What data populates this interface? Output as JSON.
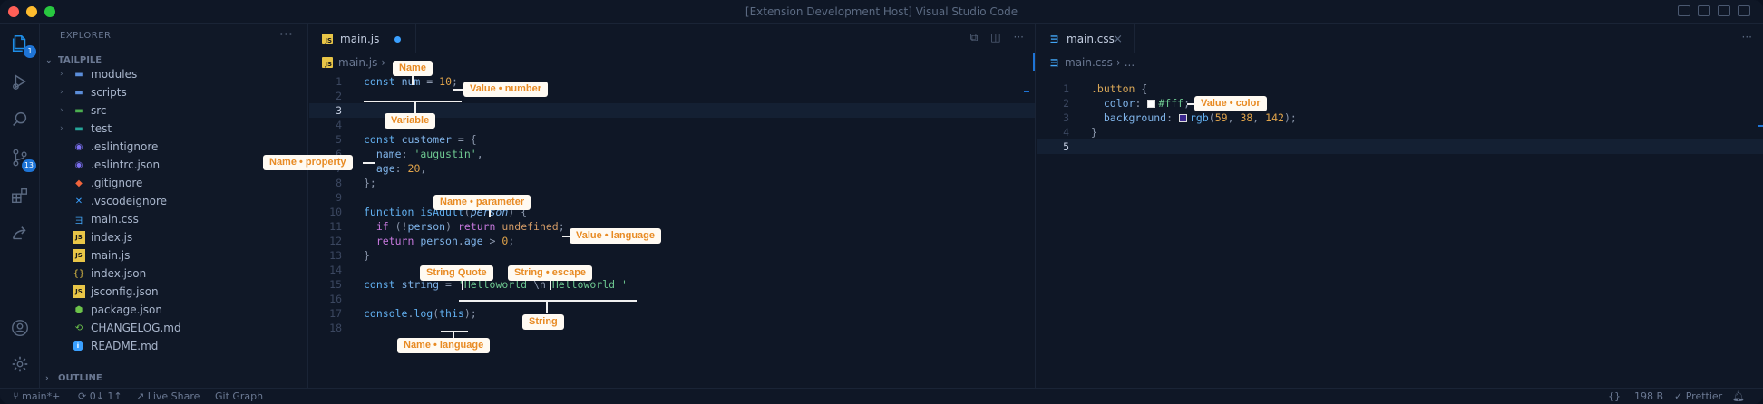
{
  "window": {
    "title": "[Extension Development Host] Visual Studio Code"
  },
  "activity": {
    "explorer_badge": "1",
    "source_control_badge": "13"
  },
  "sidebar": {
    "header": "EXPLORER",
    "root": "TAILPILE",
    "outline": "OUTLINE",
    "items": [
      {
        "label": "modules",
        "icon": "folder-icon",
        "kind": "folder"
      },
      {
        "label": "scripts",
        "icon": "folder-icon",
        "kind": "folder"
      },
      {
        "label": "src",
        "icon": "folder-icon",
        "kind": "folder"
      },
      {
        "label": "test",
        "icon": "folder-icon",
        "kind": "folder"
      },
      {
        "label": ".eslintignore",
        "icon": "eslint-icon",
        "kind": "file"
      },
      {
        "label": ".eslintrc.json",
        "icon": "eslint-icon",
        "kind": "file"
      },
      {
        "label": ".gitignore",
        "icon": "git-icon",
        "kind": "file"
      },
      {
        "label": ".vscodeignore",
        "icon": "vscode-icon",
        "kind": "file"
      },
      {
        "label": "main.css",
        "icon": "css-icon",
        "kind": "file"
      },
      {
        "label": "index.js",
        "icon": "js-icon",
        "kind": "file"
      },
      {
        "label": "main.js",
        "icon": "js-icon",
        "kind": "file"
      },
      {
        "label": "index.json",
        "icon": "json-icon",
        "kind": "file"
      },
      {
        "label": "jsconfig.json",
        "icon": "jsconfig-icon",
        "kind": "file"
      },
      {
        "label": "package.json",
        "icon": "nodejs-icon",
        "kind": "file"
      },
      {
        "label": "CHANGELOG.md",
        "icon": "changelog-icon",
        "kind": "file"
      },
      {
        "label": "README.md",
        "icon": "info-icon",
        "kind": "file"
      }
    ]
  },
  "editor_left": {
    "tab": "main.js",
    "breadcrumb": [
      "main.js",
      "..."
    ],
    "active_line": 3
  },
  "editor_right": {
    "tab": "main.css",
    "breadcrumb": [
      "main.css",
      "..."
    ],
    "active_line": 5
  },
  "callouts": {
    "name": "Name",
    "value_number": "Value • number",
    "variable": "Variable",
    "name_property": "Name • property",
    "name_parameter": "Name • parameter",
    "value_language": "Value • language",
    "string_quote": "String Quote",
    "string_escape": "String • escape",
    "string": "String",
    "name_language": "Name • language",
    "value_color": "Value • color"
  },
  "status": {
    "branch": "main*+",
    "sync": "0↓ 1↑",
    "live_share": "Live Share",
    "git_graph": "Git Graph",
    "braces": "{}",
    "size": "198 B",
    "prettier": "Prettier"
  },
  "colors": {
    "background": "#0f1726",
    "accent": "#1e74d6",
    "callout_text": "#e88b24",
    "callout_bg": "#fffaf2"
  }
}
